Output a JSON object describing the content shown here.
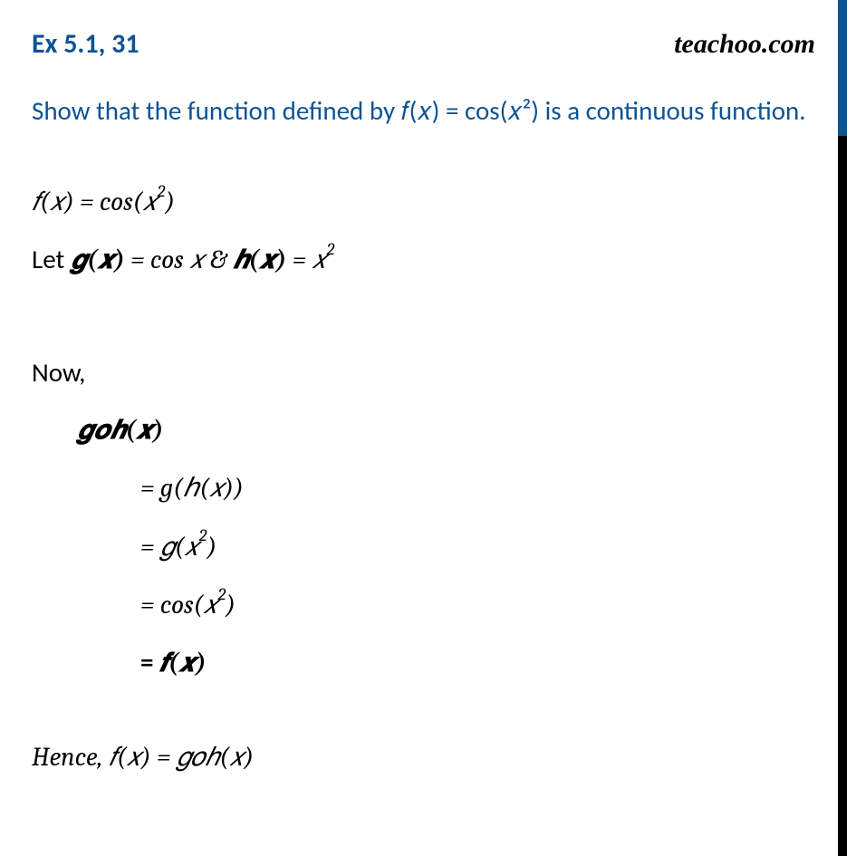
{
  "header": {
    "title": "Ex 5.1, 31",
    "brand": "teachoo.com"
  },
  "question": "Show that the function defined by 𝑓(𝑥) = cos(𝑥²) is a continuous function.",
  "lines": {
    "l1_pre": "𝑓(𝑥) = cos(𝑥",
    "l1_sup": "2",
    "l1_post": ")",
    "l2_pre": "Let ",
    "l2_g": "𝒈(𝒙)",
    "l2_mid": " =  cos 𝑥  &  ",
    "l2_h": "𝒉(𝒙)",
    "l2_post_pre": " = 𝑥",
    "l2_post_sup": "2",
    "now": "Now,",
    "goh": "𝒈𝒐𝒉(𝒙)",
    "s1": "=  g(ℎ(𝑥))",
    "s2_pre": "=  𝑔(𝑥",
    "s2_sup": "2",
    "s2_post": ")",
    "s3_pre": "=  cos(𝑥",
    "s3_sup": "2",
    "s3_post": ")",
    "s4_eq": "=  ",
    "s4_fx": "𝒇(𝒙)",
    "hence": "Hence, 𝑓(𝑥) =  𝑔𝑜ℎ(𝑥)"
  }
}
